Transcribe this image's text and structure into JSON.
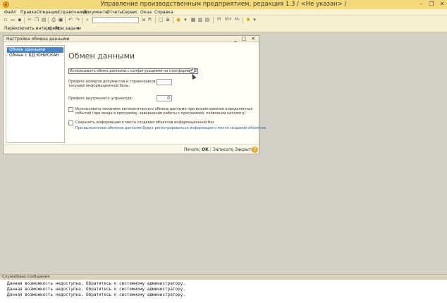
{
  "window": {
    "title": "Управление производственным предприятием, редакция 1.3 / <Не указан> /",
    "min": "–",
    "max": "❐",
    "close": "✕"
  },
  "menu": [
    "Файл",
    "Правка",
    "Операции",
    "Справочники",
    "Документы",
    "Отчеты",
    "Сервис",
    "Окна",
    "Справка"
  ],
  "toolbar": {
    "memory_buttons": [
      "M",
      "M+",
      "M-"
    ]
  },
  "panel": {
    "switch_interface": "Переключить интерфейс",
    "my_tasks": "Мои задачи"
  },
  "form": {
    "title": "Настройка обмена данными",
    "sidebar": [
      "Обмен данными",
      "Обмен с БД ЮНИСКАН"
    ],
    "heading": "Обмен данными",
    "use_exchange_label": "Использовать обмен данными с конфигурациями на платформе 8.2",
    "use_exchange_checked": "✔",
    "prefix_docs_label_1": "Префикс номеров документов и справочников",
    "prefix_docs_label_2": "текущей информационной базы:",
    "prefix_docs_value": "",
    "barcode_prefix_label": "Префикс внутреннего штрихкода:",
    "barcode_prefix_value": "0",
    "auto_exchange_label_1": "Использовать механизм автоматического обмена данными при возникновении определенных",
    "auto_exchange_label_2": "событий (при входе в программу, завершении работы с программой, появлении каталога)",
    "save_location_label": "Сохранять информацию о месте создания объектов информационной баз",
    "save_location_hint": "При выполнении обменов данными будет регистрироваться информация о месте создания объектов.",
    "footer": {
      "print": "Печать",
      "ok": "OK",
      "save": "Записать",
      "close": "Закрыть",
      "help": "?"
    }
  },
  "messages": {
    "title": "Служебные сообщения",
    "lines": [
      "Данная возможность недоступна. Обратитесь к системному администратору.",
      "Данная возможность недоступна. Обратитесь к системному администратору.",
      "Данная возможность недоступна. Обратитесь к системному администратору."
    ]
  }
}
